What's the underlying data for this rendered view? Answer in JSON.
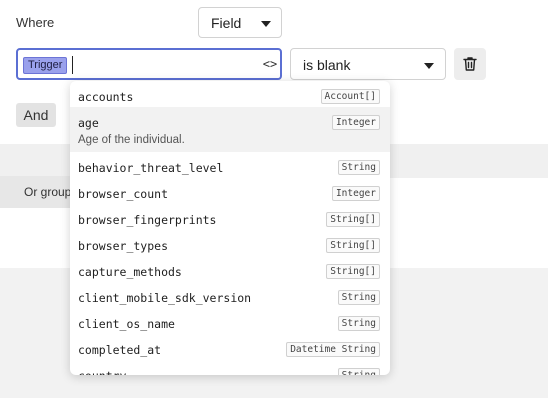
{
  "where_label": "Where",
  "field_select": {
    "value": "Field"
  },
  "trigger_input": {
    "chip_label": "Trigger",
    "code_toggle": "<>"
  },
  "operator_select": {
    "value": "is blank"
  },
  "delete_button": {
    "icon": "trash-icon"
  },
  "and_button": "And",
  "or_group_button": "Or group",
  "dropdown": {
    "options": [
      {
        "name": "accounts",
        "type": "Account[]"
      },
      {
        "name": "age",
        "type": "Integer",
        "description": "Age of the individual.",
        "highlighted": true
      },
      {
        "name": "behavior_threat_level",
        "type": "String"
      },
      {
        "name": "browser_count",
        "type": "Integer"
      },
      {
        "name": "browser_fingerprints",
        "type": "String[]"
      },
      {
        "name": "browser_types",
        "type": "String[]"
      },
      {
        "name": "capture_methods",
        "type": "String[]"
      },
      {
        "name": "client_mobile_sdk_version",
        "type": "String"
      },
      {
        "name": "client_os_name",
        "type": "String"
      },
      {
        "name": "completed_at",
        "type": "Datetime String"
      },
      {
        "name": "country",
        "type": "String"
      }
    ]
  }
}
